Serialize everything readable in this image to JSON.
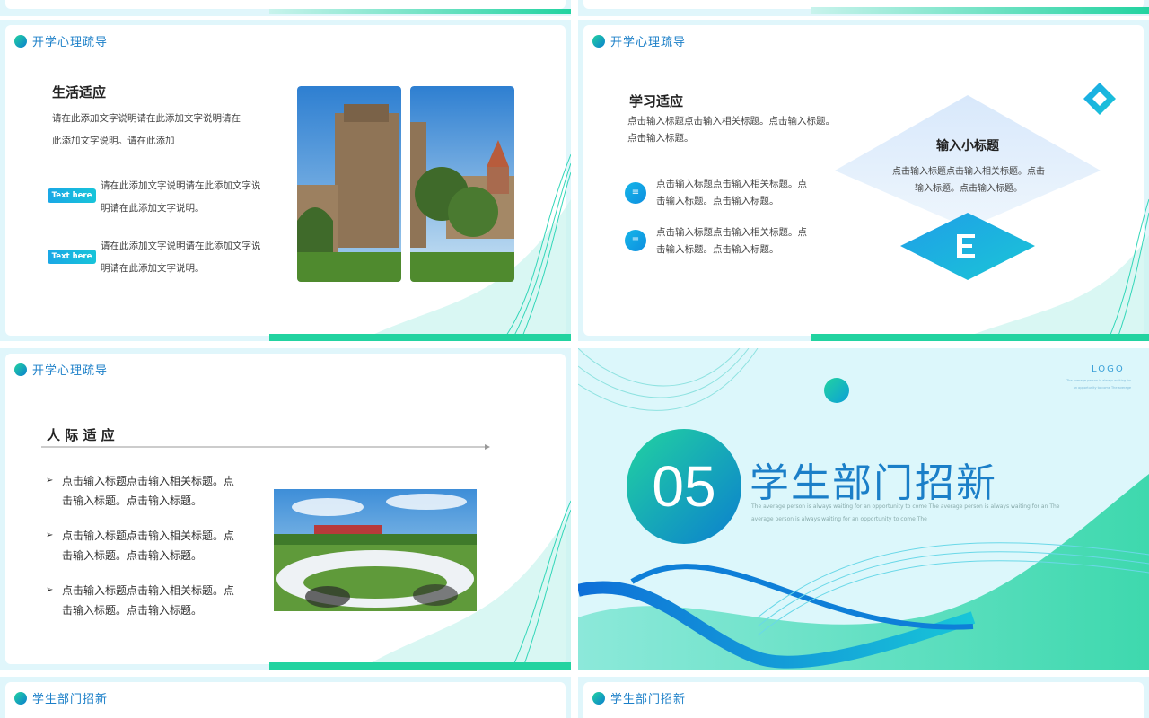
{
  "slides": {
    "life": {
      "header": "开学心理疏导",
      "title": "生活适应",
      "para": "请在此添加文字说明请在此添加文字说明请在此添加文字说明。请在此添加",
      "items": [
        {
          "pill": "Text here",
          "text": "请在此添加文字说明请在此添加文字说明请在此添加文字说明。"
        },
        {
          "pill": "Text here",
          "text": "请在此添加文字说明请在此添加文字说明请在此添加文字说明。"
        }
      ]
    },
    "study": {
      "header": "开学心理疏导",
      "title": "学习适应",
      "para": "点击输入标题点击输入相关标题。点击输入标题。点击输入标题。",
      "items": [
        {
          "icon": "document-icon",
          "text": "点击输入标题点击输入相关标题。点击输入标题。点击输入标题。"
        },
        {
          "icon": "document-icon",
          "text": "点击输入标题点击输入相关标题。点击输入标题。点击输入标题。"
        }
      ],
      "diamond_title": "输入小标题",
      "diamond_text": "点击输入标题点击输入相关标题。点击输入标题。点击输入标题。"
    },
    "social": {
      "header": "开学心理疏导",
      "title": "人 际 适 应",
      "bullets": [
        "点击输入标题点击输入相关标题。点击输入标题。点击输入标题。",
        "点击输入标题点击输入相关标题。点击输入标题。点击输入标题。",
        "点击输入标题点击输入相关标题。点击输入标题。点击输入标题。"
      ]
    },
    "section": {
      "logo": "LOGO",
      "logo_sub": "The average person is always waiting for an opportunity to come The average",
      "number": "05",
      "title": "学生部门招新",
      "sub": "The average person is always waiting for an opportunity to come The average person is always waiting for an The average person is always waiting for an opportunity to come The"
    },
    "bottom_left": {
      "header": "学生部门招新"
    },
    "bottom_right": {
      "header": "学生部门招新"
    }
  },
  "colors": {
    "accent": "#1b7fc8",
    "green": "#22d3a0",
    "bg": "#e0f6fb"
  }
}
